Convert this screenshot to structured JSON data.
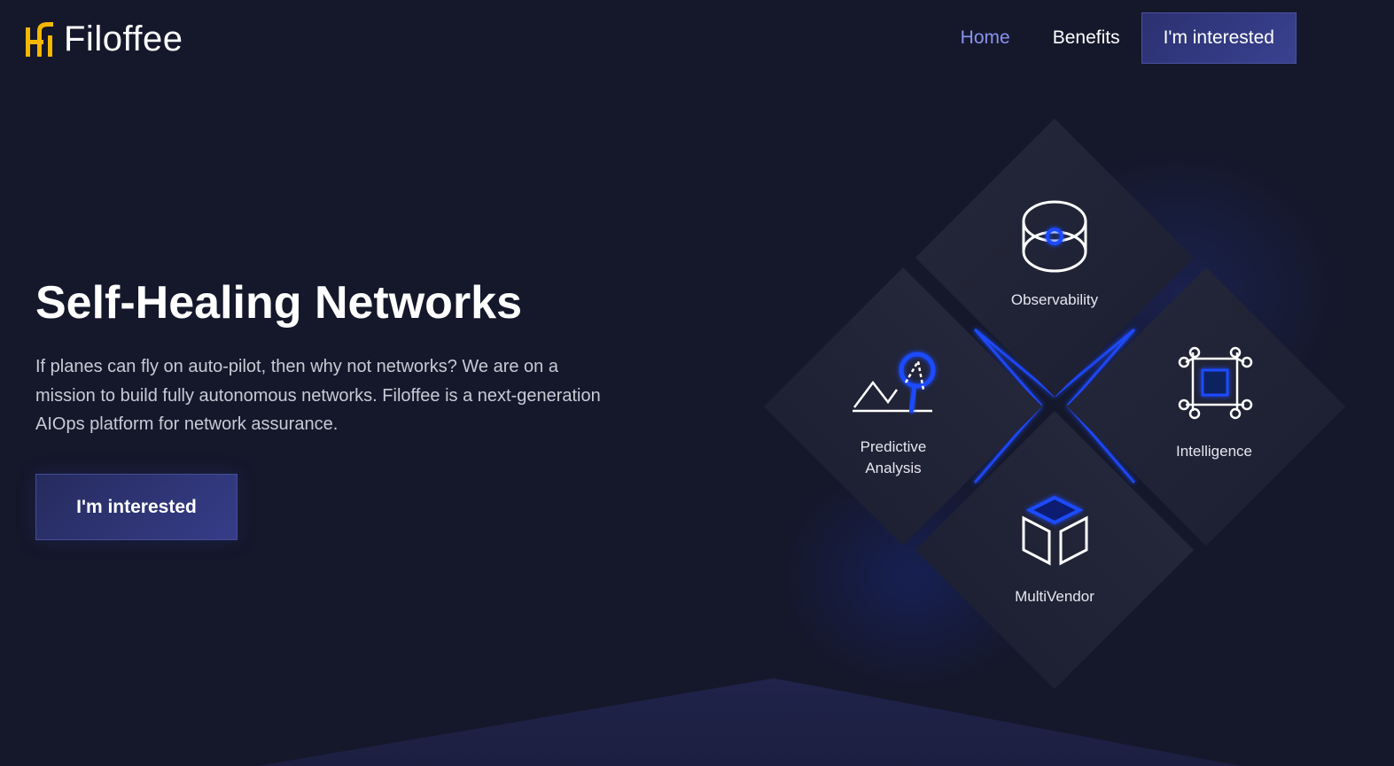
{
  "brand": {
    "name": "Filoffee",
    "logo_color": "#f5b800"
  },
  "nav": {
    "links": [
      {
        "label": "Home",
        "active": true
      },
      {
        "label": "Benefits",
        "active": false
      }
    ],
    "cta_label": "I'm interested"
  },
  "hero": {
    "title": "Self-Healing Networks",
    "description": "If planes can fly on auto-pilot, then why not networks? We are on a mission to build fully autonomous networks. Filoffee is a next-generation AIOps platform for network assurance.",
    "cta_label": "I'm interested"
  },
  "features": {
    "observability": {
      "label": "Observability",
      "icon": "eye-orbit-icon"
    },
    "predictive": {
      "label": "Predictive Analysis",
      "icon": "trend-magnifier-icon"
    },
    "intelligence": {
      "label": "Intelligence",
      "icon": "chip-nodes-icon"
    },
    "multivendor": {
      "label": "MultiVendor",
      "icon": "open-box-icon"
    }
  },
  "colors": {
    "background": "#15182b",
    "accent_blue": "#1f4bff",
    "nav_active": "#8a93f0",
    "button_bg": "#2f357a"
  }
}
